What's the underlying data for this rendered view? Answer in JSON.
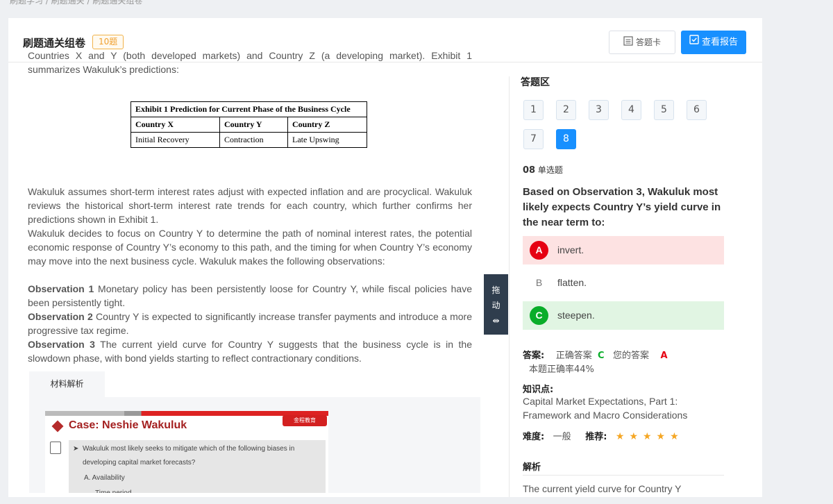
{
  "breadcrumb": "刷题学习 / 刷题通关 / 刷题通关组卷",
  "header": {
    "title": "刷题通关组卷",
    "badge": "10题",
    "answer_card_label": "答题卡",
    "report_label": "查看报告",
    "accent": "#1890ff"
  },
  "material": {
    "para1": "Countries X and Y (both developed markets) and Country Z (a developing market). Exhibit 1 summarizes Wakuluk’s predictions:",
    "exhibit": {
      "title": "Exhibit 1 Prediction for Current Phase of the Business Cycle",
      "headers": [
        "Country X",
        "Country Y",
        "Country Z"
      ],
      "row": [
        "Initial Recovery",
        "Contraction",
        "Late Upswing"
      ]
    },
    "para2": "Wakuluk assumes short-term interest rates adjust with expected inflation and are procyclical. Wakuluk reviews the historical short-term interest rate trends for each country, which further confirms her predictions shown in Exhibit 1.",
    "para3": "Wakuluk decides to focus on Country Y to determine the path of nominal interest rates, the potential economic response of Country Y’s economy to this path, and the timing for when Country Y’s economy may move into the next business cycle. Wakuluk makes the following observations:",
    "obs": [
      {
        "label": "Observation 1",
        "text": " Monetary policy has been persistently loose for Country Y, while fiscal policies have been persistently tight."
      },
      {
        "label": "Observation 2",
        "text": " Country Y is expected to significantly increase transfer payments and introduce a more progressive tax regime."
      },
      {
        "label": "Observation 3",
        "text": " The current yield curve for Country Y suggests that the business cycle is in the slowdown phase, with bond yields starting to reflect contractionary conditions."
      }
    ],
    "analysis_tab": "材料解析",
    "slide": {
      "title": "Case: Neshie Wakuluk",
      "logo": "金程教育",
      "q": "Wakuluk most likely seeks to mitigate which of the following biases in",
      "q2": "developing capital market forecasts?",
      "a": "A.  Availability",
      "b": "Time period"
    }
  },
  "drag": {
    "label1": "拖",
    "label2": "动",
    "label3": "⇹"
  },
  "answer": {
    "heading": "答题区",
    "numbers": [
      "1",
      "2",
      "3",
      "4",
      "5",
      "6",
      "7",
      "8"
    ],
    "active": "8",
    "qnum": "08",
    "qtype": "单选题",
    "question": "Based on Observation 3, Wakuluk most likely expects Country Y’s yield curve in the near term to:",
    "options": [
      {
        "letter": "A",
        "text": "invert."
      },
      {
        "letter": "B",
        "text": "flatten."
      },
      {
        "letter": "C",
        "text": "steepen."
      }
    ],
    "result_label": "答案:",
    "correct_label": "正确答案",
    "correct": "C",
    "yours_label": "您的答案",
    "yours": "A",
    "rate": "本题正确率44%",
    "kp_label": "知识点:",
    "kp": "Capital Market Expectations, Part 1: Framework and Macro Considerations",
    "difficulty_label": "难度:",
    "difficulty": "一般",
    "recommend_label": "推荐:",
    "stars": "★★★★★",
    "jx_label": "解析",
    "jx_text": "The current yield curve for Country Y"
  }
}
